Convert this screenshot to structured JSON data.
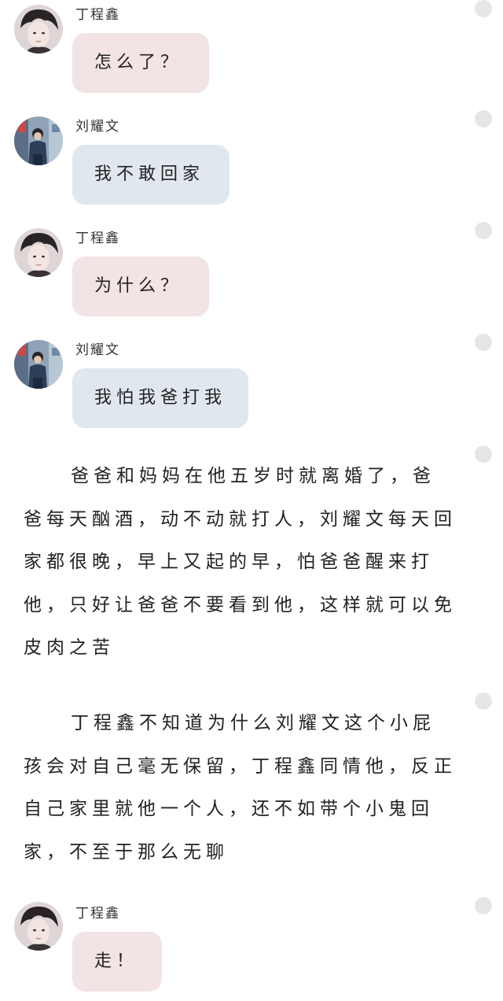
{
  "characters": {
    "ding": {
      "name": "丁程鑫"
    },
    "liu": {
      "name": "刘耀文"
    }
  },
  "messages": [
    {
      "speaker": "丁程鑫",
      "text": "怎么了？"
    },
    {
      "speaker": "刘耀文",
      "text": "我不敢回家"
    },
    {
      "speaker": "丁程鑫",
      "text": "为什么？"
    },
    {
      "speaker": "刘耀文",
      "text": "我怕我爸打我"
    },
    {
      "speaker": "丁程鑫",
      "text": "走！"
    }
  ],
  "narration": [
    "爸爸和妈妈在他五岁时就离婚了，爸爸每天酗酒，动不动就打人，刘耀文每天回家都很晚，早上又起的早，怕爸爸醒来打他，只好让爸爸不要看到他，这样就可以免皮肉之苦",
    "丁程鑫不知道为什么刘耀文这个小屁孩会对自己毫无保留，丁程鑫同情他，反正自己家里就他一个人，还不如带个小鬼回家，不至于那么无聊"
  ],
  "colors": {
    "pink_bubble": "#f2e3e4",
    "blue_bubble": "#e1e7ef",
    "side_dot": "#e6e6e6"
  },
  "icons": {
    "ding_avatar": "portrait-photo",
    "liu_avatar": "street-photo",
    "side_dot": "circle"
  }
}
